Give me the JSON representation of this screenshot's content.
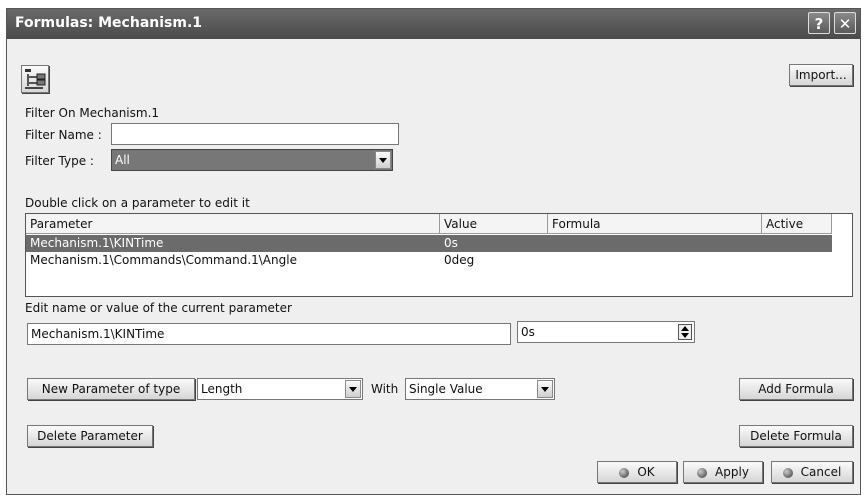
{
  "window": {
    "title": "Formulas: Mechanism.1"
  },
  "titlebar": {
    "help_glyph": "?",
    "close_glyph": "✕"
  },
  "toolbar": {
    "icon": "formula-tree-icon",
    "import_label": "Import..."
  },
  "filter": {
    "on_label": "Filter On Mechanism.1",
    "name_label": "Filter Name :",
    "name_value": "",
    "type_label": "Filter Type :",
    "type_value": "All"
  },
  "table": {
    "instruction": "Double click on a parameter to edit it",
    "columns": [
      "Parameter",
      "Value",
      "Formula",
      "Active"
    ],
    "rows": [
      {
        "parameter": "Mechanism.1\\KINTime",
        "value": "0s",
        "formula": "",
        "active": ""
      },
      {
        "parameter": "Mechanism.1\\Commands\\Command.1\\Angle",
        "value": "0deg",
        "formula": "",
        "active": ""
      }
    ],
    "selected_row": 0
  },
  "edit": {
    "label": "Edit name or value of the current parameter",
    "name_value": "Mechanism.1\\KINTime",
    "value_value": "0s"
  },
  "new_param": {
    "button_label": "New Parameter of type",
    "type_value": "Length",
    "with_label": "With",
    "with_value": "Single Value"
  },
  "actions": {
    "add_formula": "Add Formula",
    "delete_parameter": "Delete Parameter",
    "delete_formula": "Delete Formula",
    "ok": "OK",
    "apply": "Apply",
    "cancel": "Cancel"
  }
}
